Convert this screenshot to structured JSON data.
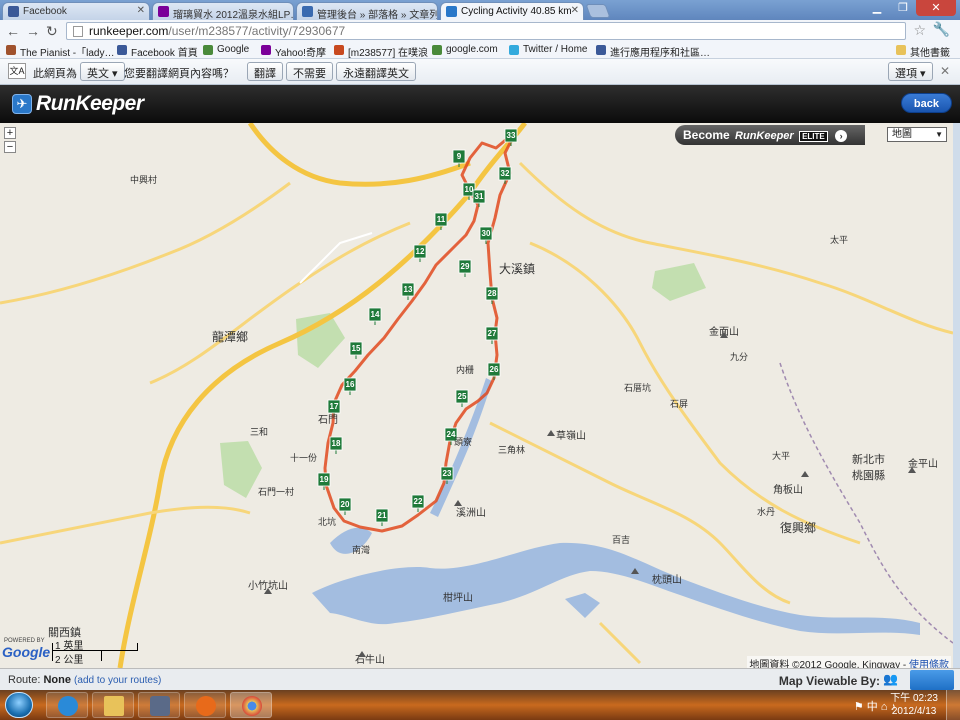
{
  "browser": {
    "tabs": [
      {
        "label": "Facebook",
        "icon": "facebook-icon",
        "color": "#3b5998"
      },
      {
        "label": "瑠璃貿水 2012溫泉水組LP…",
        "icon": "yahoo-icon",
        "color": "#7b0099"
      },
      {
        "label": "管理後台 » 部落格 » 文章列…",
        "icon": "blog-icon",
        "color": "#3a6ab0"
      },
      {
        "label": "Cycling Activity 40.85 km",
        "icon": "runkeeper-icon",
        "color": "#2a78c9"
      }
    ],
    "address": {
      "host": "runkeeper.com",
      "path": "/user/m238577/activity/72930677"
    },
    "bookmarks": [
      {
        "label": "The Pianist -「lady…",
        "icon": "film-icon",
        "color": "#a0522d"
      },
      {
        "label": "Facebook 首頁",
        "icon": "facebook-icon",
        "color": "#3b5998"
      },
      {
        "label": "Google",
        "icon": "google-icon",
        "color": "#4a8a3a"
      },
      {
        "label": "Yahoo!奇摩",
        "icon": "yahoo-icon",
        "color": "#7b0099"
      },
      {
        "label": "[m238577] 在噗浪",
        "icon": "plurk-icon",
        "color": "#c8491f"
      },
      {
        "label": "google.com",
        "icon": "google-icon",
        "color": "#4a8a3a"
      },
      {
        "label": "Twitter / Home",
        "icon": "twitter-icon",
        "color": "#33aadd"
      },
      {
        "label": "進行應用程序和社區…",
        "icon": "facebook-icon",
        "color": "#3b5998"
      }
    ],
    "other_bookmarks": "其他書籤"
  },
  "translate_bar": {
    "prefix": "此網頁為",
    "language": "英文",
    "question": "您要翻譯網頁內容嗎？",
    "translate_btn": "翻譯",
    "no_btn": "不需要",
    "always_btn": "永遠翻譯英文",
    "options_btn": "選項"
  },
  "runkeeper": {
    "logo": "RunKeeper",
    "back": "back",
    "elite": {
      "prefix": "Become",
      "brand": "RunKeeper",
      "badge": "ELITE"
    }
  },
  "map": {
    "map_type": "地圖",
    "scale_top": "1 英里",
    "scale_bottom": "2 公里",
    "google_mark": "Google",
    "powered_by": "POWERED BY",
    "copyright": "地圖資料 ©2012 Google, Kingway",
    "terms": "使用條款",
    "place_labels": [
      "龍潭鄉",
      "大溪鎮",
      "關西鎮",
      "復興鄉",
      "溪洲山",
      "金面山",
      "石門",
      "石牛山",
      "小竹坑山",
      "角板山",
      "枕頭山",
      "柑坪山",
      "金平山",
      "新北市",
      "桃園縣",
      "九分",
      "三角林",
      "石厝坑",
      "草嶺山",
      "内栅",
      "石屏",
      "百吉",
      "十一份",
      "石門一村",
      "三和",
      "北坑",
      "南灣",
      "大平",
      "太平",
      "中興村",
      "頭寮",
      "水丹"
    ],
    "km_markers": [
      9,
      10,
      11,
      12,
      13,
      14,
      15,
      16,
      17,
      18,
      19,
      20,
      21,
      22,
      23,
      24,
      25,
      26,
      27,
      28,
      29,
      30,
      31,
      32,
      33
    ]
  },
  "footer": {
    "route_label": "Route:",
    "route_value": "None",
    "add_link": "(add to your routes)",
    "viewable": "Map Viewable By:"
  },
  "taskbar": {
    "time": "下午 02:23",
    "date": "2012/4/13",
    "tray_lang": "中"
  }
}
